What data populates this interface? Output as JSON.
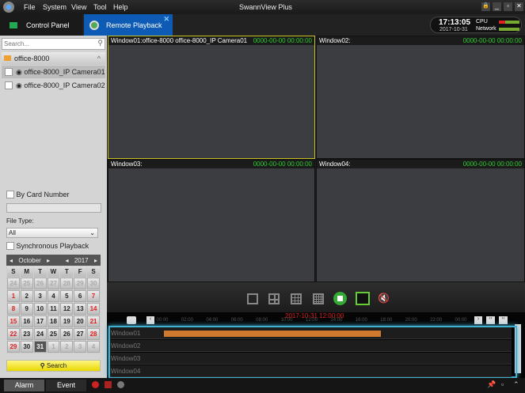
{
  "app": {
    "title": "SwannView Plus",
    "menu": [
      "File",
      "System",
      "View",
      "Tool",
      "Help"
    ]
  },
  "tabs": [
    {
      "label": "Control Panel"
    },
    {
      "label": "Remote Playback"
    }
  ],
  "status": {
    "time": "17:13:05",
    "date": "2017-10-31",
    "cpu_label": "CPU",
    "network_label": "Network"
  },
  "left": {
    "search_placeholder": "Search...",
    "group": "office-8000",
    "cameras": [
      "office-8000_IP Camera01",
      "office-8000_IP Camera02"
    ],
    "by_card": "By Card Number",
    "file_type_label": "File Type:",
    "file_type": "All",
    "sync": "Synchronous Playback",
    "month": "October",
    "year": "2017",
    "weekdays": [
      "S",
      "M",
      "T",
      "W",
      "T",
      "F",
      "S"
    ],
    "search_btn": "Search"
  },
  "calendar": [
    [
      "24",
      "25",
      "26",
      "27",
      "28",
      "29",
      "30"
    ],
    [
      "1",
      "2",
      "3",
      "4",
      "5",
      "6",
      "7"
    ],
    [
      "8",
      "9",
      "10",
      "11",
      "12",
      "13",
      "14"
    ],
    [
      "15",
      "16",
      "17",
      "18",
      "19",
      "20",
      "21"
    ],
    [
      "22",
      "23",
      "24",
      "25",
      "26",
      "27",
      "28"
    ],
    [
      "29",
      "30",
      "31",
      "1",
      "2",
      "3",
      "4"
    ]
  ],
  "windows": [
    {
      "title": "Window01:office-8000 office-8000_IP Camera01",
      "ts": "0000-00-00 00:00:00"
    },
    {
      "title": "Window02:",
      "ts": "0000-00-00 00:00:00"
    },
    {
      "title": "Window03:",
      "ts": "0000-00-00 00:00:00"
    },
    {
      "title": "Window04:",
      "ts": "0000-00-00 00:00:00"
    }
  ],
  "timeline": {
    "current": "2017-10-31 12:00:00",
    "ticks": [
      "00:00",
      "02:00",
      "04:00",
      "06:00",
      "08:00",
      "10:00",
      "12:00",
      "14:00",
      "16:00",
      "18:00",
      "20:00",
      "22:00",
      "00:00"
    ],
    "rows": [
      "Window01",
      "Window02",
      "Window03",
      "Window04"
    ],
    "recording_hours": [
      0.1,
      17.6
    ],
    "color": "#d07a30"
  },
  "bottom": {
    "alarm": "Alarm",
    "event": "Event"
  }
}
